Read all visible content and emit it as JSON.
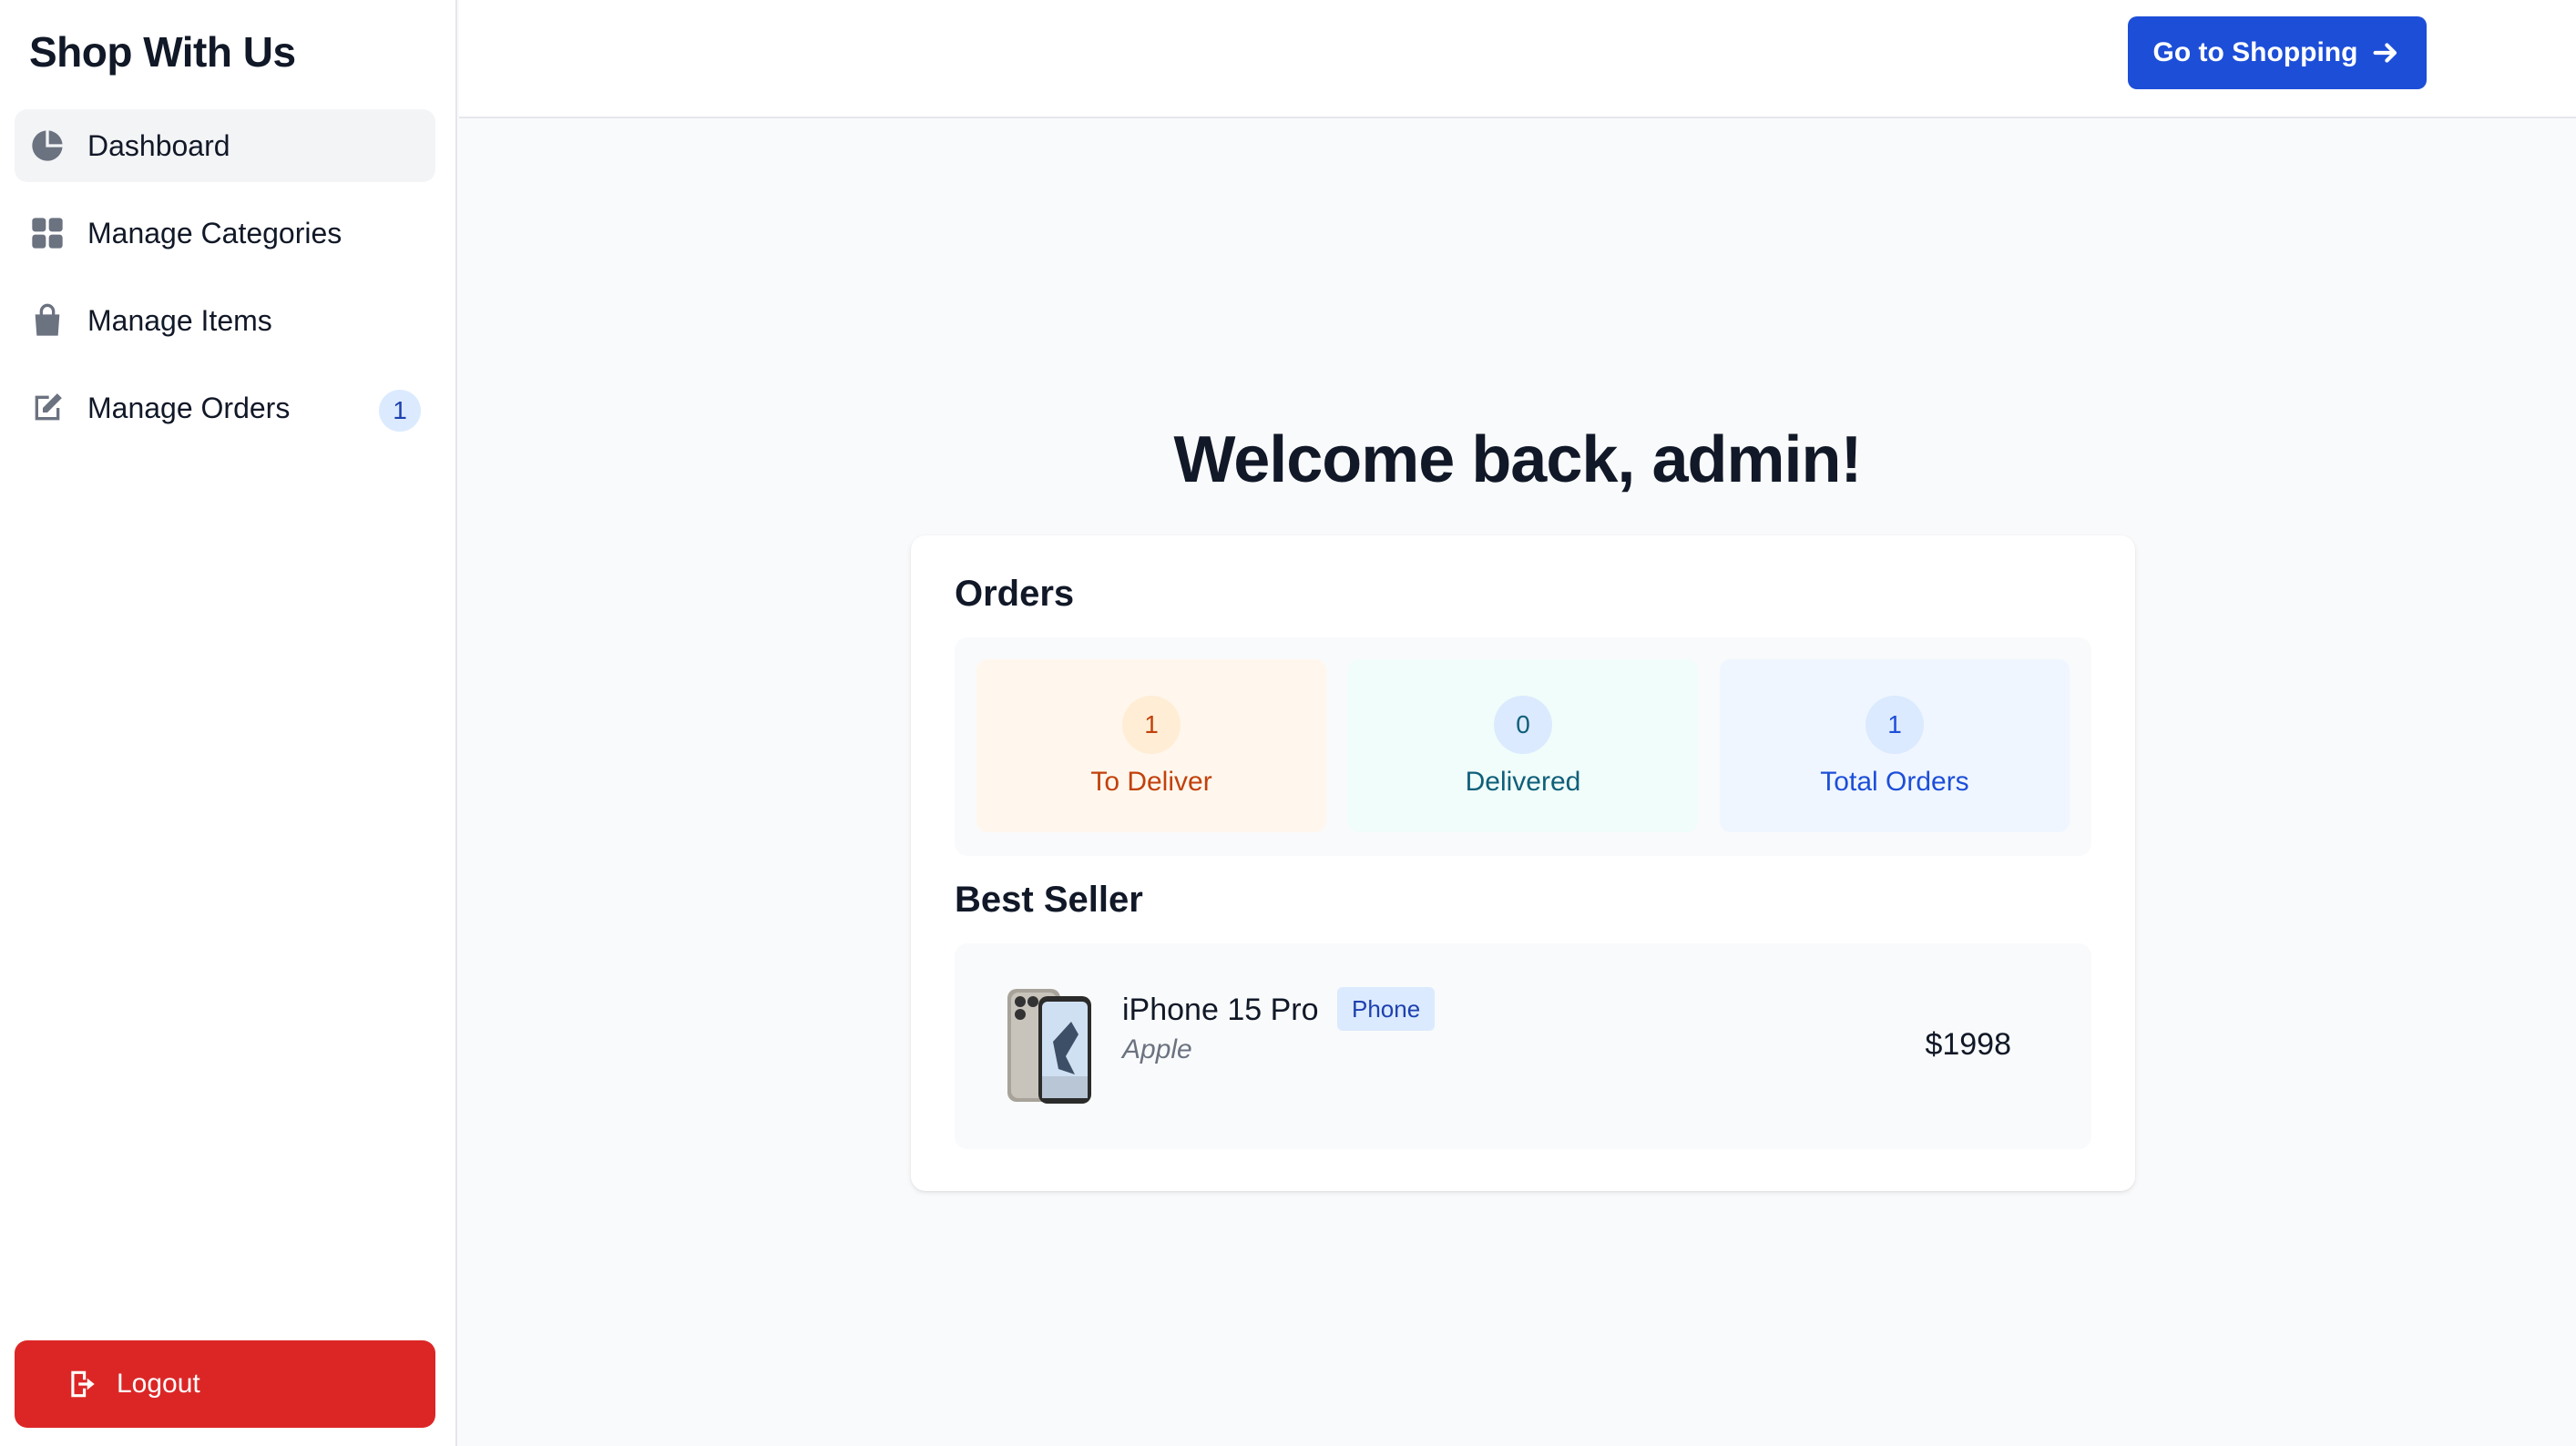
{
  "app": {
    "brand": "Shop With Us"
  },
  "sidebar": {
    "items": [
      {
        "label": "Dashboard",
        "icon": "pie-chart-icon"
      },
      {
        "label": "Manage Categories",
        "icon": "grid-icon"
      },
      {
        "label": "Manage Items",
        "icon": "shopping-bag-icon"
      },
      {
        "label": "Manage Orders",
        "icon": "edit-document-icon",
        "badge": "1"
      }
    ],
    "logout_label": "Logout"
  },
  "header": {
    "shop_button_label": "Go to Shopping"
  },
  "main": {
    "welcome": "Welcome back, admin!",
    "orders_title": "Orders",
    "stats": [
      {
        "value": "1",
        "label": "To Deliver",
        "bg": "#fff7ed",
        "circle": "#ffedd5",
        "color": "#c2410c"
      },
      {
        "value": "0",
        "label": "Delivered",
        "bg": "#f0fdfa",
        "circle": "#dbeafe",
        "color": "#0f5f7a"
      },
      {
        "value": "1",
        "label": "Total Orders",
        "bg": "#eff6ff",
        "circle": "#dbeafe",
        "color": "#1d4ed8"
      }
    ],
    "best_seller_title": "Best Seller",
    "best_seller": {
      "name": "iPhone 15 Pro",
      "brand": "Apple",
      "category": "Phone",
      "price": "$1998"
    }
  },
  "colors": {
    "accent": "#1d4ed8",
    "danger": "#dc2626",
    "badge_bg": "#dbeafe"
  }
}
